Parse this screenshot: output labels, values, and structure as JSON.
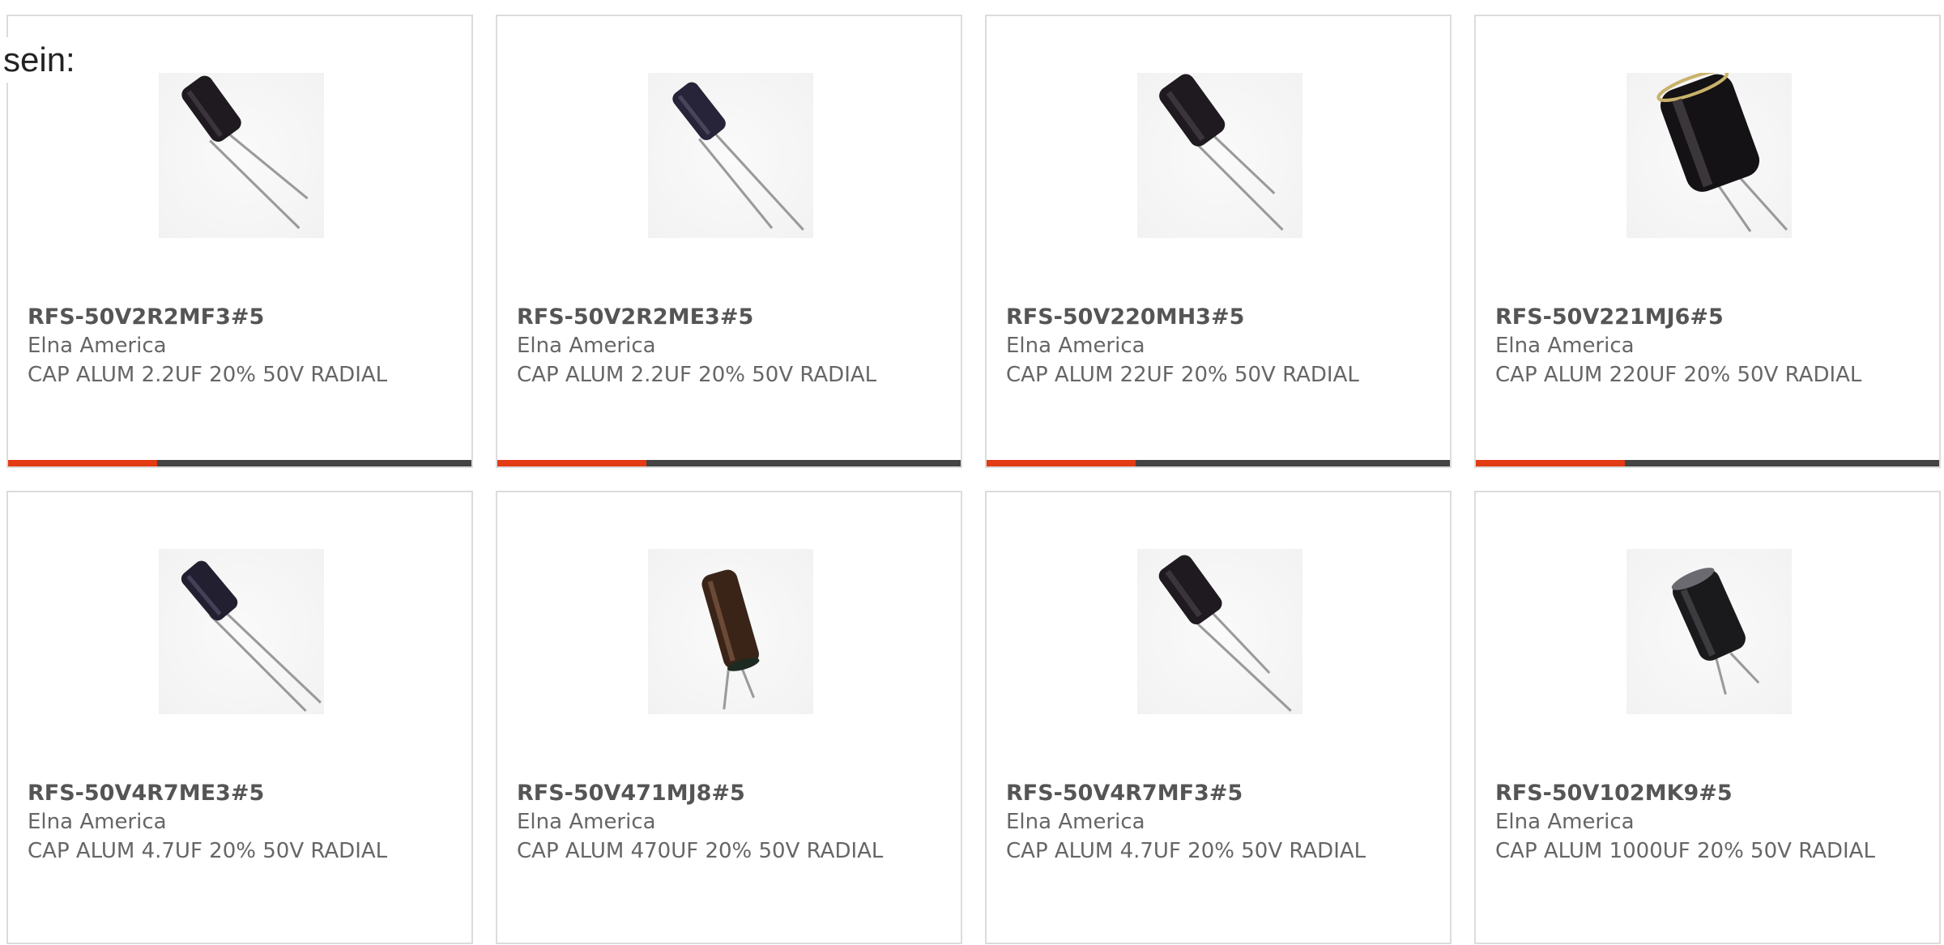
{
  "intro_text": "sein:",
  "colors": {
    "accent": "#e33b13",
    "bar": "#444444",
    "card_border": "#dcdcdc"
  },
  "products": [
    {
      "part_number": "RFS-50V2R2MF3#5",
      "manufacturer": "Elna America",
      "description": "CAP ALUM 2.2UF 20% 50V RADIAL",
      "image_icon": "capacitor-icon"
    },
    {
      "part_number": "RFS-50V2R2ME3#5",
      "manufacturer": "Elna America",
      "description": "CAP ALUM 2.2UF 20% 50V RADIAL",
      "image_icon": "capacitor-icon"
    },
    {
      "part_number": "RFS-50V220MH3#5",
      "manufacturer": "Elna America",
      "description": "CAP ALUM 22UF 20% 50V RADIAL",
      "image_icon": "capacitor-icon"
    },
    {
      "part_number": "RFS-50V221MJ6#5",
      "manufacturer": "Elna America",
      "description": "CAP ALUM 220UF 20% 50V RADIAL",
      "image_icon": "capacitor-icon"
    },
    {
      "part_number": "RFS-50V4R7ME3#5",
      "manufacturer": "Elna America",
      "description": "CAP ALUM 4.7UF 20% 50V RADIAL",
      "image_icon": "capacitor-icon"
    },
    {
      "part_number": "RFS-50V471MJ8#5",
      "manufacturer": "Elna America",
      "description": "CAP ALUM 470UF 20% 50V RADIAL",
      "image_icon": "capacitor-icon"
    },
    {
      "part_number": "RFS-50V4R7MF3#5",
      "manufacturer": "Elna America",
      "description": "CAP ALUM 4.7UF 20% 50V RADIAL",
      "image_icon": "capacitor-icon"
    },
    {
      "part_number": "RFS-50V102MK9#5",
      "manufacturer": "Elna America",
      "description": "CAP ALUM 1000UF 20% 50V RADIAL",
      "image_icon": "capacitor-icon"
    }
  ]
}
